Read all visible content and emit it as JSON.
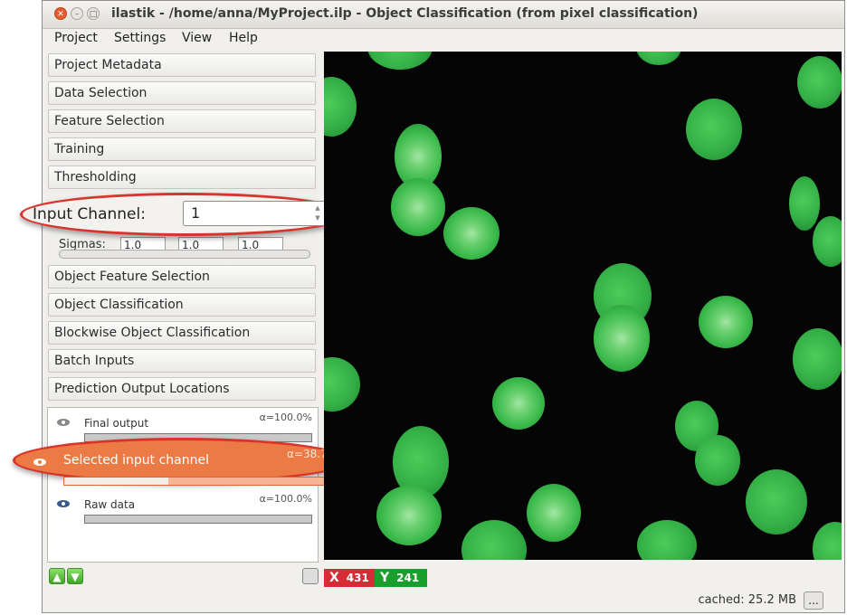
{
  "window": {
    "title": "ilastik - /home/anna/MyProject.ilp - Object Classification (from pixel classification)"
  },
  "menu": [
    {
      "label": "Project"
    },
    {
      "label": "Settings"
    },
    {
      "label": "View"
    },
    {
      "label": "Help"
    }
  ],
  "applets_top": [
    {
      "label": "Project Metadata"
    },
    {
      "label": "Data Selection"
    },
    {
      "label": "Feature Selection"
    },
    {
      "label": "Training"
    },
    {
      "label": "Thresholding"
    }
  ],
  "thresholding": {
    "input_channel_label": "Input Channel:",
    "input_channel_value": "1",
    "sigmas_label": "Sigmas:",
    "sigmas": [
      "1.0",
      "1.0",
      "1.0"
    ]
  },
  "applets_bottom": [
    {
      "label": "Object Feature Selection"
    },
    {
      "label": "Object Classification"
    },
    {
      "label": "Blockwise Object Classification"
    },
    {
      "label": "Batch Inputs"
    },
    {
      "label": "Prediction Output Locations"
    }
  ],
  "layers": [
    {
      "name": "Final output",
      "alpha": "α=100.0%",
      "opacity": 1.0
    },
    {
      "name": "Selected input channel",
      "alpha": "α=38.7",
      "opacity": 0.4
    },
    {
      "name": "Raw data",
      "alpha": "α=100.0%",
      "opacity": 1.0
    }
  ],
  "coords": {
    "x_label": "X",
    "x_value": "431",
    "y_label": "Y",
    "y_value": "241"
  },
  "status": {
    "cached": "cached: 25.2 MB",
    "cache_button": "..."
  },
  "colors": {
    "highlight_border": "#d8342c",
    "selected_layer": "#ec7a45",
    "cell_green": "#34b046",
    "x_badge": "#d62c35",
    "y_badge": "#1a9f2c"
  }
}
